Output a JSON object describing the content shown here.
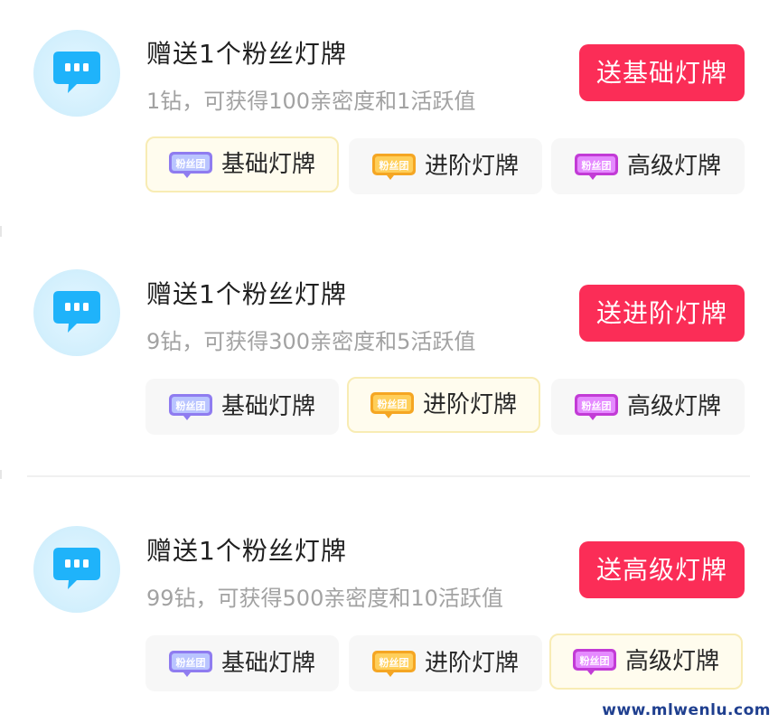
{
  "gifts": [
    {
      "title": "赠送1个粉丝灯牌",
      "subtitle": "1钻，可获得100亲密度和1活跃值",
      "button_label": "送基础灯牌",
      "selected_tier": 0
    },
    {
      "title": "赠送1个粉丝灯牌",
      "subtitle": "9钻，可获得300亲密度和5活跃值",
      "button_label": "送进阶灯牌",
      "selected_tier": 1
    },
    {
      "title": "赠送1个粉丝灯牌",
      "subtitle": "99钻，可获得500亲密度和10活跃值",
      "button_label": "送高级灯牌",
      "selected_tier": 2
    }
  ],
  "tiers": [
    {
      "label": "基础灯牌",
      "badge_text": "粉丝团",
      "badge_icon": "basic-fan-badge-icon",
      "color": "#8f7cf0"
    },
    {
      "label": "进阶灯牌",
      "badge_text": "粉丝团",
      "badge_icon": "advanced-fan-badge-icon",
      "color": "#f5a623"
    },
    {
      "label": "高级灯牌",
      "badge_text": "粉丝团",
      "badge_icon": "premium-fan-badge-icon",
      "color": "#c23bd6"
    }
  ],
  "colors": {
    "accent": "#fb2d57",
    "chat_icon": "#1fb3fa",
    "selected_border": "#f8ecb4"
  },
  "watermark": "www.mlwenlu.com"
}
